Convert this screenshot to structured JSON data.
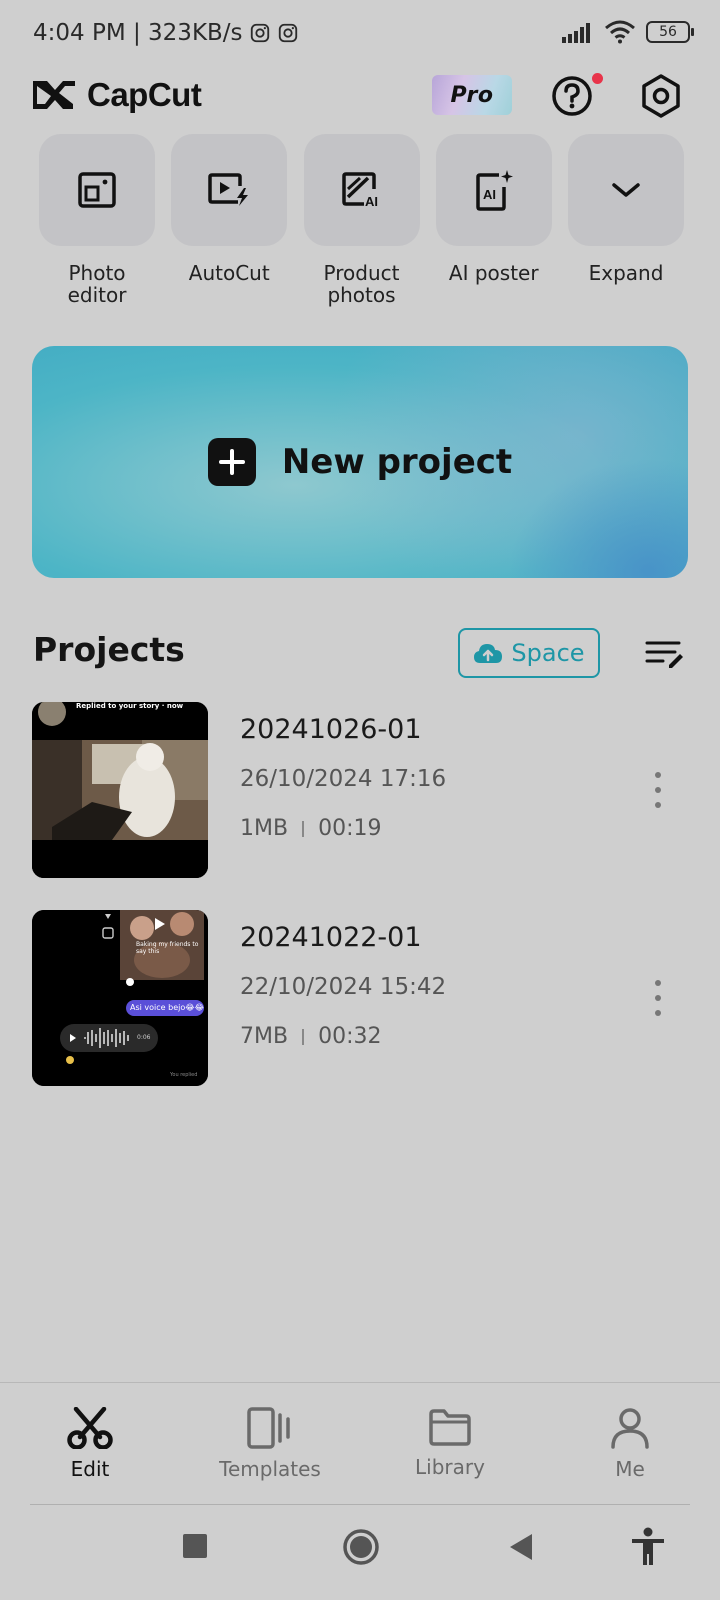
{
  "status_bar": {
    "time_speed": "4:04 PM | 323KB/s",
    "battery": "56"
  },
  "header": {
    "app_name": "CapCut",
    "pro_label": "Pro"
  },
  "tools": [
    {
      "label": "Photo editor",
      "icon": "photo-editor-icon"
    },
    {
      "label": "AutoCut",
      "icon": "autocut-icon"
    },
    {
      "label": "Product photos",
      "icon": "product-photos-icon"
    },
    {
      "label": "AI poster",
      "icon": "ai-poster-icon"
    },
    {
      "label": "Expand",
      "icon": "chevron-down-icon"
    }
  ],
  "new_project": {
    "label": "New project"
  },
  "projects": {
    "title": "Projects",
    "space_label": "Space",
    "items": [
      {
        "name": "20241026-01",
        "date": "26/10/2024 17:16",
        "size": "1MB",
        "duration": "00:19",
        "thumb_caption": "Replied to your story · now"
      },
      {
        "name": "20241022-01",
        "date": "22/10/2024 15:42",
        "size": "7MB",
        "duration": "00:32",
        "thumb_chat": "Asi voice bejo😂😂",
        "thumb_caption2": "Baking my friends to say this",
        "thumb_audio_time": "0:06",
        "thumb_footer": "You replied"
      }
    ]
  },
  "bottom_nav": {
    "items": [
      {
        "label": "Edit",
        "icon": "scissors-icon",
        "active": true
      },
      {
        "label": "Templates",
        "icon": "templates-icon",
        "active": false
      },
      {
        "label": "Library",
        "icon": "folder-icon",
        "active": false
      },
      {
        "label": "Me",
        "icon": "person-icon",
        "active": false
      }
    ]
  },
  "colors": {
    "accent": "#1e96a6",
    "background": "#cfcfcf",
    "notification": "#e8344a"
  }
}
